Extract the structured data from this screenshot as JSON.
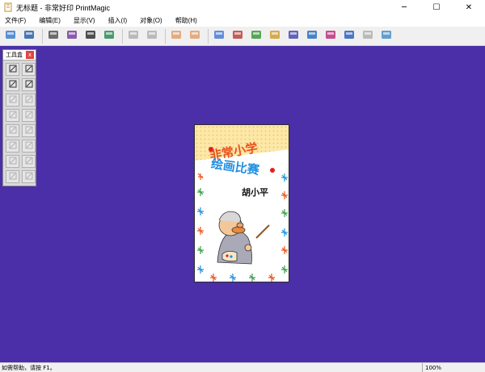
{
  "window": {
    "title": "无标题 - 非常好印 PrintMagic",
    "minimize_glyph": "─",
    "maximize_glyph": "☐",
    "close_glyph": "✕"
  },
  "menu": [
    "文件(F)",
    "编辑(E)",
    "显示(V)",
    "插入(I)",
    "对象(O)",
    "帮助(H)"
  ],
  "toolbar": {
    "buttons": [
      {
        "name": "open-icon",
        "color": "#3b7fd0"
      },
      {
        "name": "save-icon",
        "color": "#2d5fa8"
      },
      {
        "name": "print-icon",
        "color": "#555555"
      },
      {
        "name": "print-preview-icon",
        "color": "#7a3fa0"
      },
      {
        "name": "camera-icon",
        "color": "#333333"
      },
      {
        "name": "scanner-icon",
        "color": "#2e8b57"
      },
      {
        "name": "cut-icon",
        "color": "#b0b0b0"
      },
      {
        "name": "copy-icon",
        "color": "#b0b0b0"
      },
      {
        "name": "undo-icon",
        "color": "#e0a070"
      },
      {
        "name": "redo-icon",
        "color": "#e0a070"
      },
      {
        "name": "insert-image-icon",
        "color": "#4a7dd8"
      },
      {
        "name": "zoom-icon",
        "color": "#c04040"
      },
      {
        "name": "picture-icon",
        "color": "#3a9a3a"
      },
      {
        "name": "edit-icon",
        "color": "#d0a030"
      },
      {
        "name": "photo-icon",
        "color": "#4a4ab0"
      },
      {
        "name": "frame-icon",
        "color": "#2a70c0"
      },
      {
        "name": "layout-icon",
        "color": "#c03080"
      },
      {
        "name": "collage-icon",
        "color": "#3060c0"
      },
      {
        "name": "magic-icon",
        "color": "#b0b0b0"
      },
      {
        "name": "wizard-icon",
        "color": "#4a90c8"
      }
    ]
  },
  "toolbox": {
    "title": "工具盒",
    "close_glyph": "x",
    "tools": [
      {
        "name": "select-tool-icon",
        "enabled": true
      },
      {
        "name": "text-tool-icon",
        "enabled": true
      },
      {
        "name": "pen-tool-icon",
        "enabled": true
      },
      {
        "name": "clipart-tool-icon",
        "enabled": true
      },
      {
        "name": "align-left-icon",
        "enabled": false
      },
      {
        "name": "align-right-icon",
        "enabled": false
      },
      {
        "name": "bring-front-icon",
        "enabled": false
      },
      {
        "name": "send-back-icon",
        "enabled": false
      },
      {
        "name": "group-icon",
        "enabled": false
      },
      {
        "name": "ungroup-icon",
        "enabled": false
      },
      {
        "name": "flip-h-icon",
        "enabled": false
      },
      {
        "name": "flip-v-icon",
        "enabled": false
      },
      {
        "name": "rotate-icon",
        "enabled": false
      },
      {
        "name": "crop-icon",
        "enabled": false
      },
      {
        "name": "lock-icon",
        "enabled": false
      },
      {
        "name": "unlock-icon",
        "enabled": false
      }
    ]
  },
  "card": {
    "line1": "非常小学",
    "line2": "绘画比赛",
    "name": "胡小平"
  },
  "status": {
    "message": "如需帮助，请按 F1。",
    "zoom": "100%"
  },
  "colors": {
    "workspace": "#4a2fa8",
    "title_orange": "#e8541e",
    "title_blue": "#1f8fe0"
  }
}
